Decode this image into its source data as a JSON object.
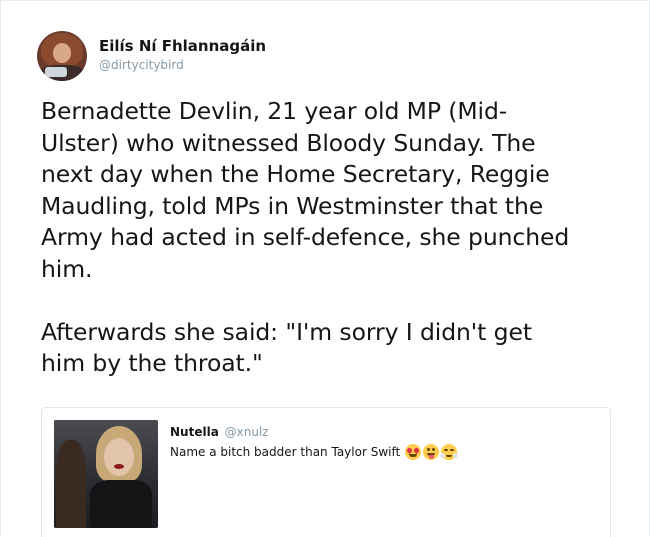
{
  "tweet": {
    "author": {
      "display_name": "Eilís Ní Fhlannagáin",
      "handle": "@dirtycitybird"
    },
    "text": "Bernadette Devlin, 21 year old MP (Mid-\nUlster) who witnessed Bloody Sunday. The\nnext day when the Home Secretary, Reggie\nMaudling, told MPs in Westminster that the\nArmy had acted in self-defence, she punched\nhim.\n\nAfterwards she said: \"I'm sorry I didn't get\nhim by the throat.\"",
    "quoted": {
      "display_name": "Nutella",
      "handle": "@xnulz",
      "text": "Name a bitch badder than Taylor Swift",
      "emojis": [
        "heart-eyes-emoji",
        "tongue-out-emoji",
        "steam-nose-emoji"
      ]
    }
  },
  "colors": {
    "text": "#14171a",
    "secondary": "#8899a6",
    "border": "#e1e8ed"
  }
}
